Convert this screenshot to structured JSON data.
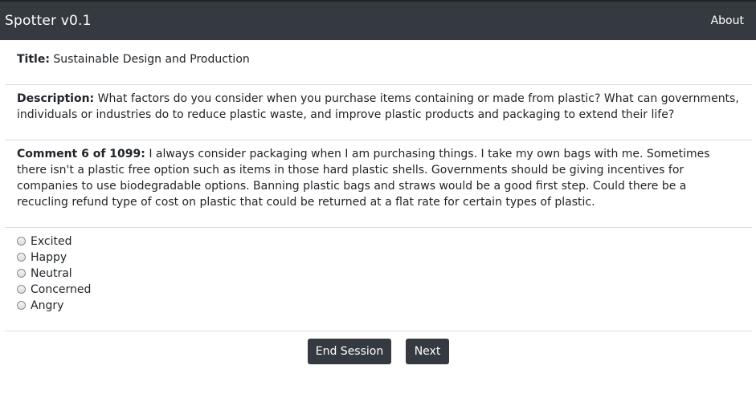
{
  "navbar": {
    "brand": "Spotter v0.1",
    "about_label": "About"
  },
  "title": {
    "label": "Title:",
    "value": "Sustainable Design and Production"
  },
  "description": {
    "label": "Description:",
    "value": "What factors do you consider when you purchase items containing or made from plastic? What can governments, individuals or industries do to reduce plastic waste, and improve plastic products and packaging to extend their life?"
  },
  "comment": {
    "label": "Comment 6 of 1099:",
    "value": "I always consider packaging when I am purchasing things. I take my own bags with me. Sometimes there isn't a plastic free option such as items in those hard plastic shells. Governments should be giving incentives for companies to use biodegradable options. Banning plastic bags and straws would be a good first step. Could there be a recucling refund type of cost on plastic that could be returned at a flat rate for certain types of plastic."
  },
  "sentiment_options": [
    {
      "label": "Excited"
    },
    {
      "label": "Happy"
    },
    {
      "label": "Neutral"
    },
    {
      "label": "Concerned"
    },
    {
      "label": "Angry"
    }
  ],
  "buttons": {
    "end_session": "End Session",
    "next": "Next"
  },
  "colors": {
    "navbar_bg": "#343a40",
    "button_bg": "#343a40",
    "text": "#212529"
  }
}
